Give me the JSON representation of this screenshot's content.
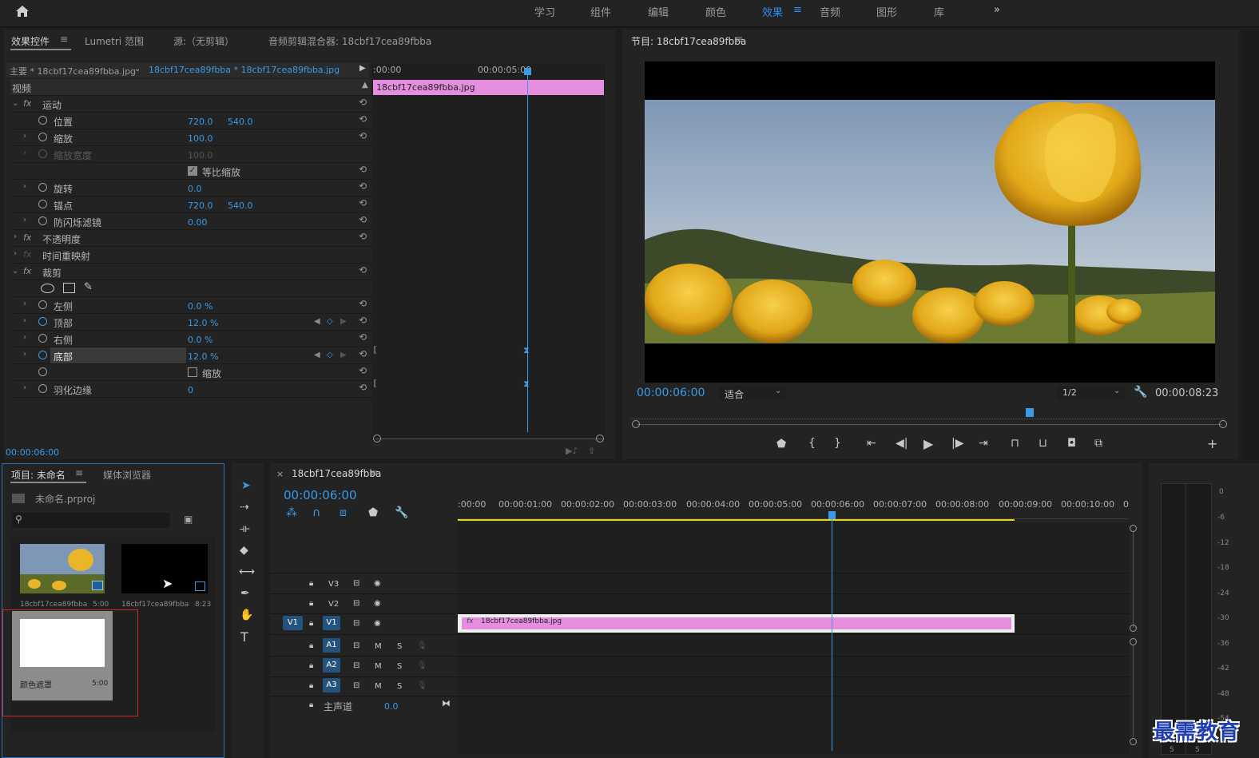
{
  "workspaces": [
    "学习",
    "组件",
    "编辑",
    "颜色",
    "效果",
    "音频",
    "图形",
    "库"
  ],
  "active_workspace": "效果",
  "source_panel": {
    "tabs": [
      "效果控件",
      "Lumetri 范围",
      "源:（无剪辑）",
      "音频剪辑混合器: 18cbf17cea89fbba"
    ],
    "master_clip": "主要 * 18cbf17cea89fbba.jpg",
    "sequence_clip": "18cbf17cea89fbba * 18cbf17cea89fbba.jpg",
    "mini_ruler": [
      ":00:00",
      "00:00:05:00"
    ],
    "mini_clip": "18cbf17cea89fbba.jpg",
    "section_video": "视频",
    "timecode": "00:00:06:00",
    "rows": [
      {
        "label": "运动",
        "fx": true,
        "indent": 0
      },
      {
        "label": "位置",
        "v1": "720.0",
        "v2": "540.0",
        "indent": 1
      },
      {
        "label": "缩放",
        "v1": "100.0",
        "indent": 1
      },
      {
        "label": "缩放宽度",
        "v1": "100.0",
        "indent": 1,
        "dim": true
      },
      {
        "label": "等比缩放",
        "checkbox": true,
        "checked": true
      },
      {
        "label": "旋转",
        "v1": "0.0",
        "indent": 1
      },
      {
        "label": "锚点",
        "v1": "720.0",
        "v2": "540.0",
        "indent": 1
      },
      {
        "label": "防闪烁滤镜",
        "v1": "0.00",
        "indent": 1
      },
      {
        "label": "不透明度",
        "fx": true,
        "indent": 0
      },
      {
        "label": "时间重映射",
        "fx": true,
        "indent": 0,
        "dimfx": true
      },
      {
        "label": "裁剪",
        "fx": true,
        "indent": 0
      },
      {
        "label": "",
        "shapes": true
      },
      {
        "label": "左侧",
        "v1": "0.0 %",
        "indent": 1
      },
      {
        "label": "顶部",
        "v1": "12.0 %",
        "indent": 1,
        "animated": true
      },
      {
        "label": "右侧",
        "v1": "0.0 %",
        "indent": 1
      },
      {
        "label": "底部",
        "v1": "12.0 %",
        "indent": 1,
        "animated": true,
        "selected": true
      },
      {
        "label": "缩放",
        "checkbox": true,
        "checked": false
      },
      {
        "label": "羽化边缘",
        "v1": "0",
        "indent": 1
      }
    ]
  },
  "program": {
    "title": "节目: 18cbf17cea89fbba",
    "timecode": "00:00:06:00",
    "fit": "适合",
    "resolution": "1/2",
    "duration": "00:00:08:23",
    "playhead_fraction": 0.68
  },
  "project": {
    "tabs": [
      "项目: 未命名",
      "媒体浏览器"
    ],
    "file": "未命名.prproj",
    "search_placeholder": "",
    "items": [
      {
        "name": "18cbf17cea89fbba",
        "dur": "5:00"
      },
      {
        "name": "18cbf17cea89fbba",
        "dur": "8:23"
      },
      {
        "name": "颜色遮罩",
        "dur": "5:00"
      }
    ]
  },
  "timeline": {
    "tab": "18cbf17cea89fbba",
    "timecode": "00:00:06:00",
    "ruler": [
      ":00:00",
      "00:00:01:00",
      "00:00:02:00",
      "00:00:03:00",
      "00:00:04:00",
      "00:00:05:00",
      "00:00:06:00",
      "00:00:07:00",
      "00:00:08:00",
      "00:00:09:00",
      "00:00:10:00",
      "0"
    ],
    "video_tracks": [
      "V3",
      "V2",
      "V1"
    ],
    "audio_tracks": [
      "A1",
      "A2",
      "A3"
    ],
    "source_patch": "V1",
    "clip": "18cbf17cea89fbba.jpg",
    "master_label": "主声道",
    "master_value": "0.0",
    "mute": "M",
    "solo": "S"
  },
  "meter": {
    "labels": [
      "0",
      "-6",
      "-12",
      "-18",
      "-24",
      "-30",
      "-36",
      "-42",
      "-48",
      "-54"
    ],
    "solo": [
      "S",
      "S"
    ]
  },
  "watermark": "最需教育"
}
